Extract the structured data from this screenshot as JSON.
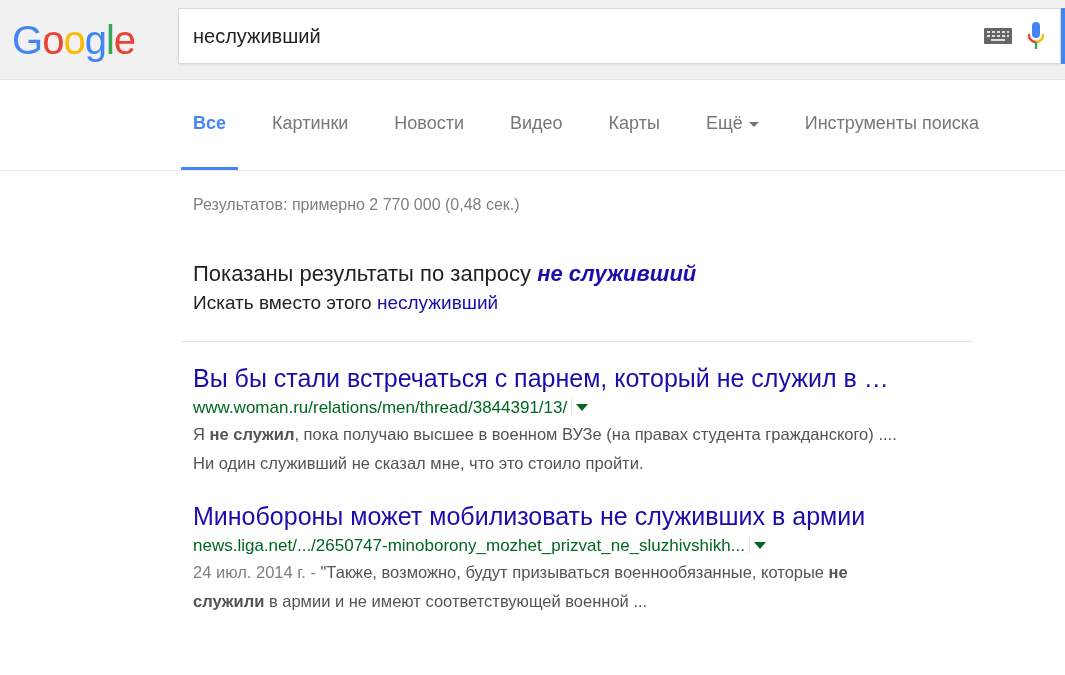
{
  "logo": "Google",
  "search": {
    "value": "неслуживший"
  },
  "tabs": [
    {
      "label": "Все",
      "selected": true,
      "kind": "tab"
    },
    {
      "label": "Картинки",
      "selected": false,
      "kind": "tab"
    },
    {
      "label": "Новости",
      "selected": false,
      "kind": "tab"
    },
    {
      "label": "Видео",
      "selected": false,
      "kind": "tab"
    },
    {
      "label": "Карты",
      "selected": false,
      "kind": "tab"
    },
    {
      "label": "Ещё",
      "selected": false,
      "kind": "menu"
    },
    {
      "label": "Инструменты поиска",
      "selected": false,
      "kind": "tools"
    }
  ],
  "result_stats": "Результатов: примерно 2 770 000 (0,48 сек.)",
  "spelling": {
    "showing_label": "Показаны результаты по запросу",
    "corrected_query": "не служивший",
    "instead_label": "Искать вместо этого",
    "original_query": "неслуживший"
  },
  "results": [
    {
      "title": "Вы бы стали встречаться с парнем, который не служил в …",
      "url": "www.woman.ru/relations/men/thread/3844391/13/",
      "snippet": "Я **не служил**, пока получаю высшее в военном ВУЗе (на правах студента гражданского) .... Ни один служивший не сказал мне, что это стоило пройти."
    },
    {
      "title": "Минобороны может мобилизовать не служивших в армии",
      "url": "news.liga.net/.../2650747-minoborony_mozhet_prizvat_ne_sluzhivshikh...",
      "date": "24 июл. 2014 г. - ",
      "snippet": "\"Также, возможно, будут призываться военнообязанные, которые **не служили** в армии и не имеют соответствующей военной ..."
    }
  ]
}
